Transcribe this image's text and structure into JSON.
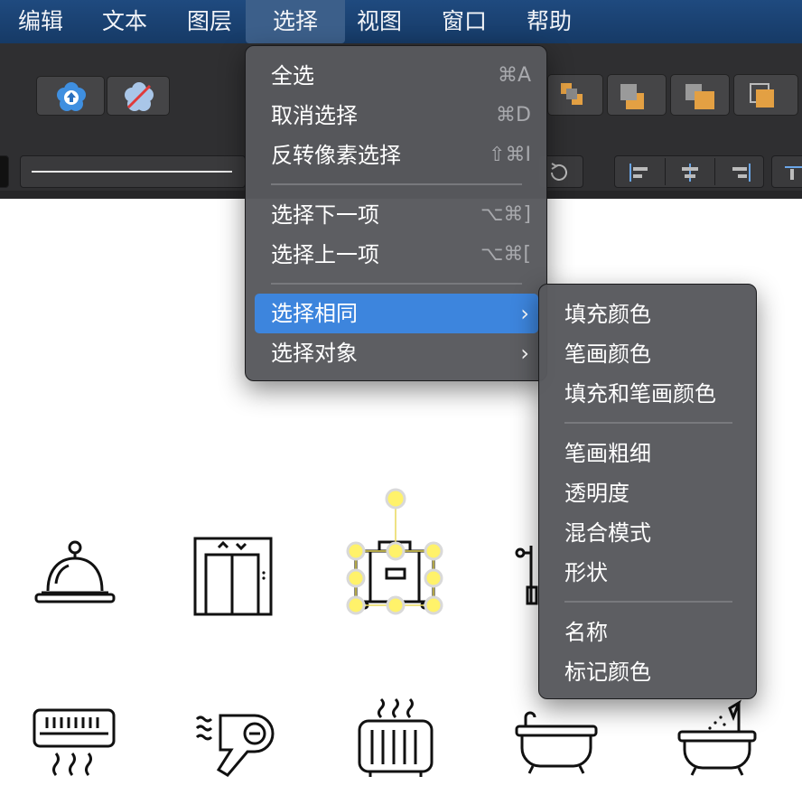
{
  "menubar": {
    "items": [
      "编辑",
      "文本",
      "图层",
      "选择",
      "视图",
      "窗口",
      "帮助"
    ],
    "active": "选择"
  },
  "select_menu": {
    "items": [
      {
        "label": "全选",
        "shortcut": "⌘A"
      },
      {
        "label": "取消选择",
        "shortcut": "⌘D"
      },
      {
        "label": "反转像素选择",
        "shortcut": "⇧⌘I"
      },
      {
        "label": "选择下一项",
        "shortcut": "⌥⌘]"
      },
      {
        "label": "选择上一项",
        "shortcut": "⌥⌘["
      },
      {
        "label": "选择相同",
        "submenu": true,
        "highlighted": true
      },
      {
        "label": "选择对象",
        "submenu": true
      }
    ]
  },
  "select_same_submenu": {
    "items": [
      "填充颜色",
      "笔画颜色",
      "填充和笔画颜色",
      "笔画粗细",
      "透明度",
      "混合模式",
      "形状",
      "名称",
      "标记颜色"
    ]
  },
  "canvas_icons": [
    "service-bell-icon",
    "elevator-icon",
    "luggage-icon",
    "coat-rack-icon",
    "air-conditioner-icon",
    "hair-dryer-icon",
    "heater-icon",
    "bathtub-icon",
    "shower-bathtub-icon"
  ],
  "colors": {
    "menubar_bg": "#1f4a7f",
    "toolbar_bg": "#2f2f31",
    "menu_bg": "#58595d",
    "highlight": "#3d85dd",
    "selection_handle": "#fff26a"
  }
}
